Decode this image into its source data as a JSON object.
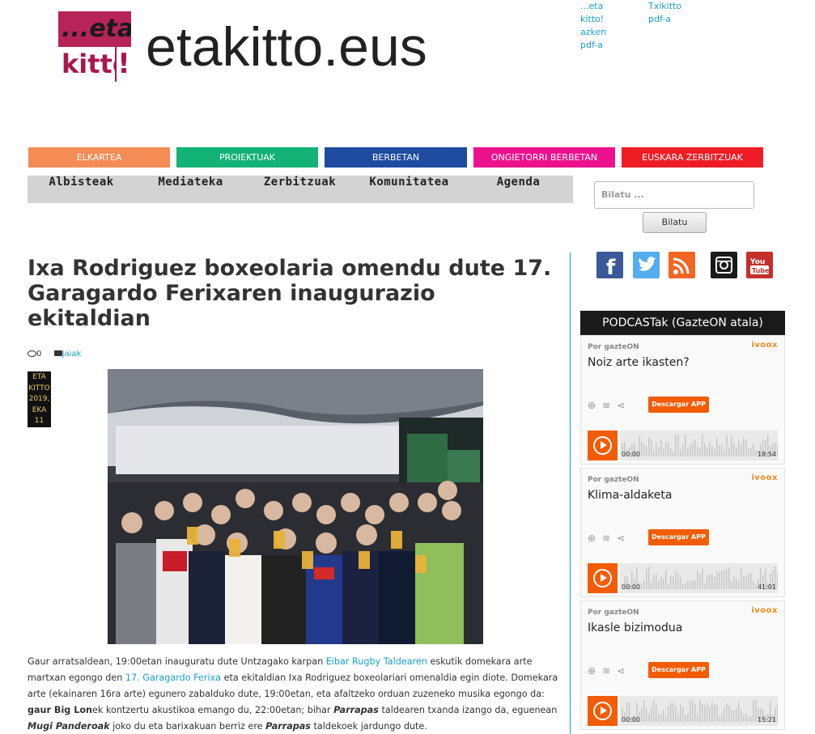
{
  "header": {
    "logo_line1": "...eta",
    "logo_line2": "kitto",
    "logo_line3": "!",
    "site_title": "etakitto.eus",
    "pdf_link_1": "...eta kitto! azken pdf-a",
    "pdf_link_2": "Txikitto pdf-a"
  },
  "color_nav": [
    {
      "label": "ELKARTEA",
      "color": "#f58b55"
    },
    {
      "label": "PROIEKTUAK",
      "color": "#13b277"
    },
    {
      "label": "BERBETAN",
      "color": "#1e4aa0"
    },
    {
      "label": "ONGIETORRI BERBETAN",
      "color": "#ed118d"
    },
    {
      "label": "EUSKARA ZERBITZUAK",
      "color": "#ee1c25"
    }
  ],
  "main_nav": [
    "Albisteak",
    "Mediateka",
    "Zerbitzuak",
    "Komunitatea",
    "Agenda"
  ],
  "search": {
    "placeholder": "Bilatu ...",
    "button": "Bilatu"
  },
  "article": {
    "title": "Ixa Rodriguez boxeolaria omendu dute 17. Garagardo Ferixaren inaugurazio ekitaldian",
    "comments": "0",
    "category": "Jaiak",
    "date_lines": [
      "ETA",
      "KITTO",
      "2019,",
      "EKA",
      "11"
    ],
    "body": {
      "p1": "Gaur arratsaldean, 19:00etan inauguratu dute Untzagako karpan ",
      "link1": "Eibar Rugby Taldearen",
      "p2": " eskutik domekara arte martxan egongo den ",
      "link2": "17. Garagardo Ferixa",
      "p3": " eta ekitaldian Ixa Rodriguez boxeolariari omenaldia egin diote. Domekara arte (ekainaren 16ra arte) egunero zabalduko dute, 19:00etan, eta afaltzeko orduan zuzeneko musika egongo da: ",
      "b1": "gaur Big Lon",
      "p4": "ek kontzertu akustikoa emango du, 22:00etan; bihar ",
      "i1": "Parrapas",
      "p5": " taldearen txanda izango da, eguenean ",
      "i2": "Mugi Panderoak",
      "p6": " joko du eta barixakuan berriz ere ",
      "i3": "Parrapas",
      "p7": " taldekoek jardungo dute."
    }
  },
  "social": [
    {
      "icon": "facebook-icon",
      "color": "#3b5998"
    },
    {
      "icon": "twitter-icon",
      "color": "#55acee"
    },
    {
      "icon": "rss-icon",
      "color": "#f26522"
    },
    {
      "icon": "instagram-icon",
      "color": "#1a1a1a"
    },
    {
      "icon": "youtube-icon",
      "color": "#c4302b"
    }
  ],
  "podcasts": {
    "header": "PODCASTak (GazteON atala)",
    "items": [
      {
        "by": "Por gazteON",
        "brand": "ivoox",
        "title": "Noiz arte ikasten?",
        "app": "Descargar APP",
        "time_start": "00:00",
        "time_end": "18:54"
      },
      {
        "by": "Por gazteON",
        "brand": "ivoox",
        "title": "Klima-aldaketa",
        "app": "Descargar APP",
        "time_start": "00:00",
        "time_end": "41:01"
      },
      {
        "by": "Por gazteON",
        "brand": "ivoox",
        "title": "Ikasle bizimodua",
        "app": "Descargar APP",
        "time_start": "00:00",
        "time_end": "15:21"
      }
    ]
  }
}
